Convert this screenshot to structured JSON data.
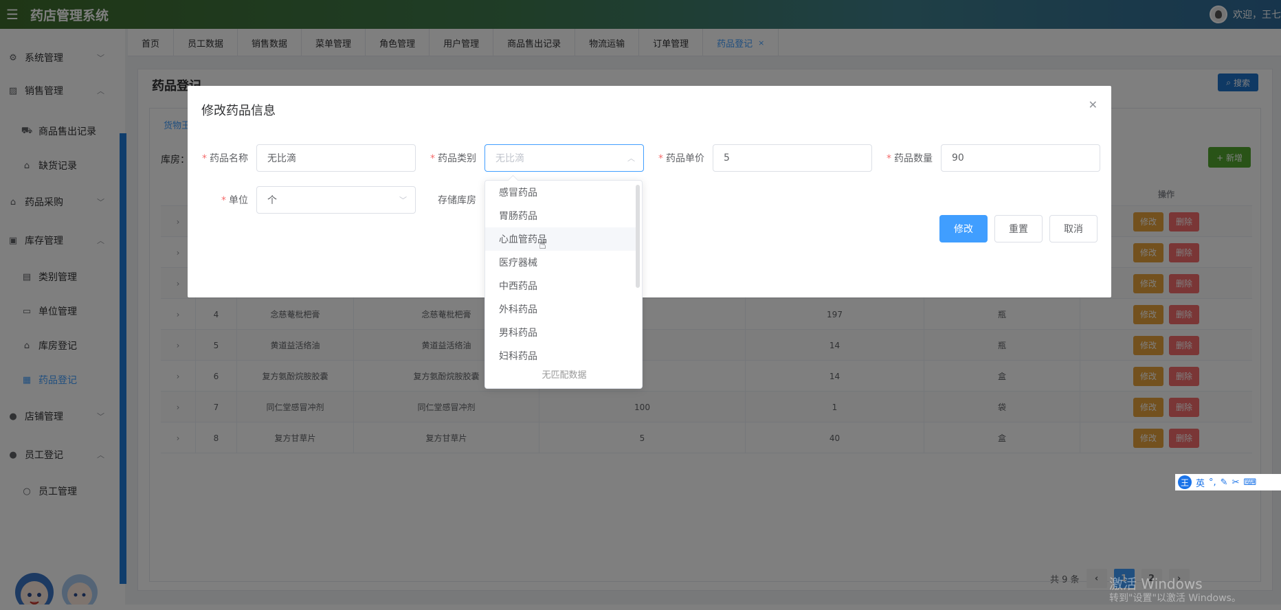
{
  "app": {
    "title": "药店管理系统",
    "welcome": "欢迎，王七"
  },
  "sidebar": {
    "items": [
      {
        "label": "系统管理",
        "icon": "gear-icon",
        "expanded": false
      },
      {
        "label": "销售管理",
        "icon": "chart-icon",
        "expanded": true
      },
      {
        "label": "商品售出记录",
        "icon": "truck-icon"
      },
      {
        "label": "缺货记录",
        "icon": "bag-icon"
      },
      {
        "label": "药品采购",
        "icon": "bank-icon",
        "expanded": false
      },
      {
        "label": "库存管理",
        "icon": "briefcase-icon",
        "expanded": true
      },
      {
        "label": "类别管理",
        "icon": "document-icon"
      },
      {
        "label": "单位管理",
        "icon": "monitor-icon"
      },
      {
        "label": "库房登记",
        "icon": "house-icon"
      },
      {
        "label": "药品登记",
        "icon": "cart-icon",
        "active": true
      },
      {
        "label": "店铺管理",
        "icon": "user-icon",
        "expanded": false
      },
      {
        "label": "员工登记",
        "icon": "user-icon",
        "expanded": true
      },
      {
        "label": "员工管理",
        "icon": "person-icon"
      }
    ]
  },
  "tabs": [
    {
      "label": "首页"
    },
    {
      "label": "员工数据"
    },
    {
      "label": "销售数据"
    },
    {
      "label": "菜单管理"
    },
    {
      "label": "角色管理"
    },
    {
      "label": "用户管理"
    },
    {
      "label": "商品售出记录"
    },
    {
      "label": "物流运输"
    },
    {
      "label": "订单管理"
    },
    {
      "label": "药品登记",
      "active": true,
      "close": "×"
    }
  ],
  "main": {
    "page_title": "药品登记",
    "search_label": "搜索",
    "filter_tab": "货物王",
    "warehouse_label": "库房：",
    "add_label": "+ 新增",
    "ops_header": "操作",
    "rows": [
      {
        "idx": "4",
        "name": "念慈菴枇杷膏",
        "alias": "念慈菴枇杷膏",
        "price": "",
        "qty": "197",
        "unit": "瓶"
      },
      {
        "idx": "5",
        "name": "黄道益活络油",
        "alias": "黄道益活络油",
        "price": "",
        "qty": "14",
        "unit": "瓶"
      },
      {
        "idx": "6",
        "name": "复方氨酚烷胺胶囊",
        "alias": "复方氨酚烷胺胶囊",
        "price": "",
        "qty": "14",
        "unit": "盒"
      },
      {
        "idx": "7",
        "name": "同仁堂感冒冲剂",
        "alias": "同仁堂感冒冲剂",
        "price": "100",
        "qty": "1",
        "unit": "袋"
      },
      {
        "idx": "8",
        "name": "复方甘草片",
        "alias": "复方甘草片",
        "price": "5",
        "qty": "40",
        "unit": "盒"
      }
    ],
    "edit_label": "修改",
    "delete_label": "删除",
    "pager": {
      "total": "共 9 条",
      "pages": [
        "1",
        "2"
      ],
      "current": "1"
    }
  },
  "dialog": {
    "title": "修改药品信息",
    "fields": {
      "name_label": "药品名称",
      "name_value": "无比滴",
      "category_label": "药品类别",
      "category_placeholder": "无比滴",
      "price_label": "药品单价",
      "price_value": "5",
      "qty_label": "药品数量",
      "qty_value": "90",
      "unit_label": "单位",
      "unit_value": "个",
      "store_label": "存储库房"
    },
    "buttons": {
      "submit": "修改",
      "reset": "重置",
      "cancel": "取消"
    }
  },
  "dropdown": {
    "options": [
      "感冒药品",
      "胃肠药品",
      "心血管药品",
      "医疗器械",
      "中西药品",
      "外科药品",
      "男科药品",
      "妇科药品"
    ],
    "hovered": "心血管药品",
    "empty_text": "无匹配数据"
  },
  "ime": {
    "logo": "王",
    "mode": "英"
  },
  "watermark": {
    "line1": "激活 Windows",
    "line2": "转到\"设置\"以激活 Windows。"
  }
}
